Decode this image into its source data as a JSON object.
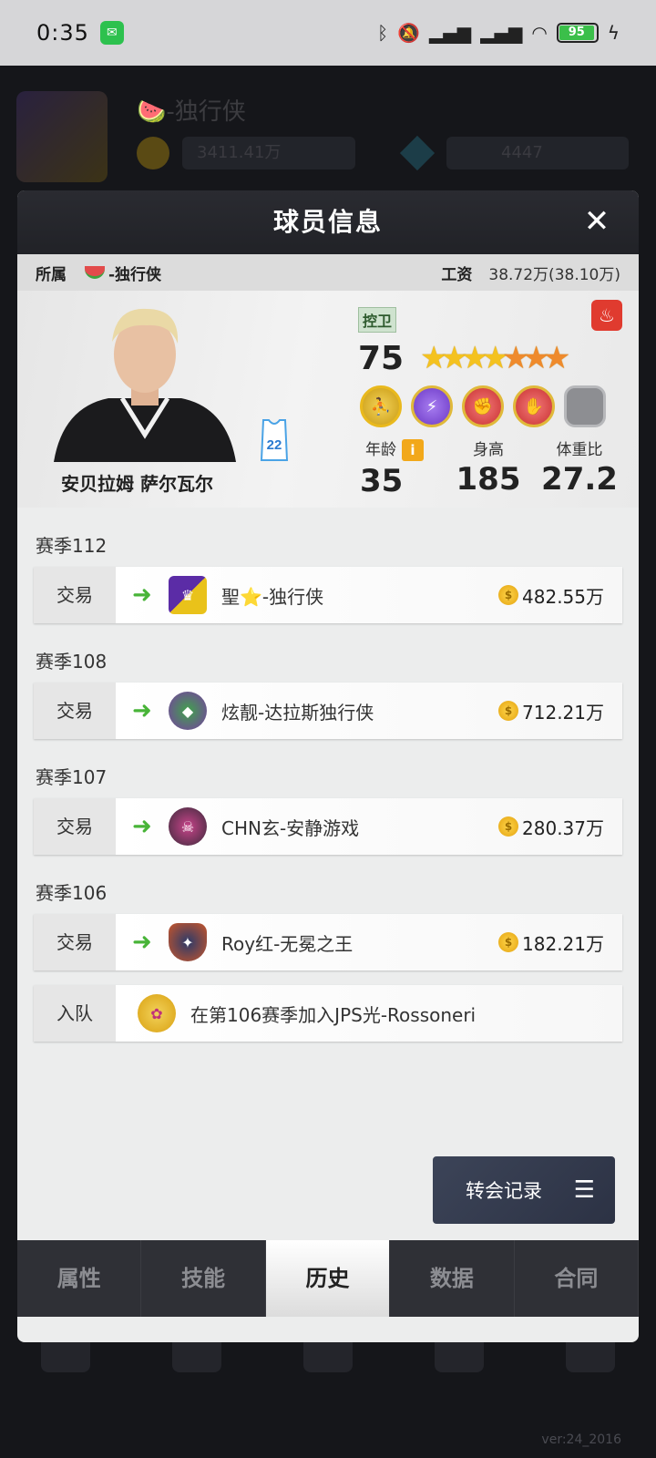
{
  "statusbar": {
    "time": "0:35",
    "battery": "95"
  },
  "background": {
    "team_name": "🍉-独行侠",
    "currency_1": "3411.41万",
    "currency_2": "4447",
    "version": "ver:24_2016"
  },
  "modal": {
    "title": "球员信息",
    "affiliation_label": "所属",
    "affiliation_team": "-独行侠",
    "salary_label": "工资",
    "salary_value": "38.72万(38.10万)"
  },
  "player": {
    "name": "安贝拉姆 萨尔瓦尔",
    "position": "控卫",
    "rating": "75",
    "jersey_number": "22",
    "stars": 7,
    "age_label": "年龄",
    "age": "35",
    "height_label": "身高",
    "height": "185",
    "weight_ratio_label": "体重比",
    "weight_ratio": "27.2"
  },
  "history": [
    {
      "season": "赛季112",
      "rows": [
        {
          "type": "交易",
          "team": "聖⭐-独行侠",
          "price": "482.55万",
          "logo_color": "#4b2b8a"
        }
      ]
    },
    {
      "season": "赛季108",
      "rows": [
        {
          "type": "交易",
          "team": "炫靓-达拉斯独行侠",
          "price": "712.21万",
          "logo_color": "#3a7a3a"
        }
      ]
    },
    {
      "season": "赛季107",
      "rows": [
        {
          "type": "交易",
          "team": "CHN玄-安静游戏",
          "price": "280.37万",
          "logo_color": "#8a2b5a"
        }
      ]
    },
    {
      "season": "赛季106",
      "rows": [
        {
          "type": "交易",
          "team": "Roy红-无冕之王",
          "price": "182.21万",
          "logo_color": "#c9562a"
        },
        {
          "type": "入队",
          "team": "在第106赛季加入JPS光-Rossoneri",
          "price": "",
          "logo_color": "#e8b81a"
        }
      ]
    }
  ],
  "transfer_button": {
    "label": "转会记录"
  },
  "tabs": [
    {
      "label": "属性",
      "active": false
    },
    {
      "label": "技能",
      "active": false
    },
    {
      "label": "历史",
      "active": true
    },
    {
      "label": "数据",
      "active": false
    },
    {
      "label": "合同",
      "active": false
    }
  ],
  "icons": {
    "close": "close-icon",
    "fire": "fire-icon",
    "menu": "menu-icon",
    "coin": "coin-icon",
    "arrow": "arrow-right-icon"
  }
}
